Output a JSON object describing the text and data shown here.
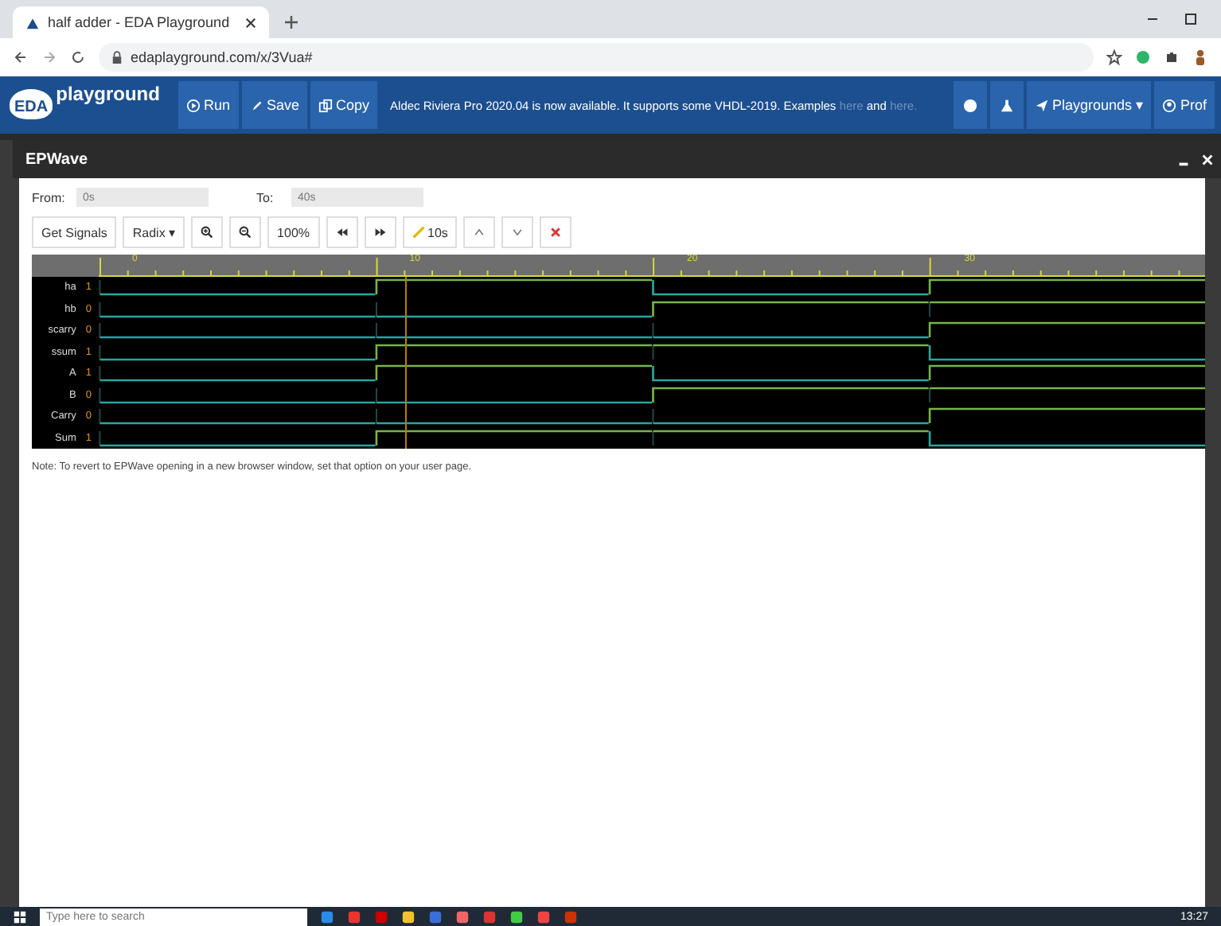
{
  "browser": {
    "tab_title": "half adder - EDA Playground",
    "url": "edaplayground.com/x/3Vua#"
  },
  "header": {
    "logo_small": "EDA",
    "logo_text": "playground",
    "buttons": [
      {
        "label": "Run",
        "kind": "run"
      },
      {
        "label": "Save",
        "kind": "save"
      },
      {
        "label": "Copy",
        "kind": "copy"
      }
    ],
    "announcement": "Aldec Riviera Pro 2020.04 is now available. It supports some VHDL-2019. Examples",
    "link_1": "here",
    "and_text": "and",
    "link_2": "here.",
    "right": [
      {
        "label": "Playgrounds ▾",
        "kind": "playgrounds"
      },
      {
        "label": "Prof",
        "kind": "profile"
      }
    ]
  },
  "epwave": {
    "title": "EPWave",
    "from_label": "From:",
    "from_value": "0s",
    "to_label": "To:",
    "to_value": "40s",
    "toolbar": [
      {
        "label": "Get Signals",
        "kind": "text"
      },
      {
        "label": "Radix ▾",
        "kind": "text"
      },
      {
        "kind": "zoom-in"
      },
      {
        "kind": "zoom-out"
      },
      {
        "label": "100%",
        "kind": "text"
      },
      {
        "kind": "prev"
      },
      {
        "kind": "next"
      },
      {
        "label": "10s",
        "kind": "marker"
      },
      {
        "kind": "up"
      },
      {
        "kind": "down"
      },
      {
        "kind": "delete"
      }
    ],
    "ruler": [
      "0",
      "10",
      "20",
      "30"
    ],
    "signals": [
      {
        "name": "ha",
        "value": "1",
        "high": [
          false,
          true,
          false,
          true
        ]
      },
      {
        "name": "hb",
        "value": "0",
        "high": [
          false,
          false,
          true,
          true
        ]
      },
      {
        "name": "scarry",
        "value": "0",
        "high": [
          false,
          false,
          false,
          true
        ]
      },
      {
        "name": "ssum",
        "value": "1",
        "high": [
          false,
          true,
          true,
          false
        ]
      },
      {
        "name": "A",
        "value": "1",
        "high": [
          false,
          true,
          false,
          true
        ]
      },
      {
        "name": "B",
        "value": "0",
        "high": [
          false,
          false,
          true,
          true
        ]
      },
      {
        "name": "Carry",
        "value": "0",
        "high": [
          false,
          false,
          false,
          true
        ]
      },
      {
        "name": "Sum",
        "value": "1",
        "high": [
          false,
          true,
          true,
          false
        ]
      }
    ],
    "note": "Note: To revert to EPWave opening in a new browser window, set that option on your user page."
  },
  "taskbar": {
    "search_placeholder": "Type here to search",
    "clock": "13:27"
  }
}
